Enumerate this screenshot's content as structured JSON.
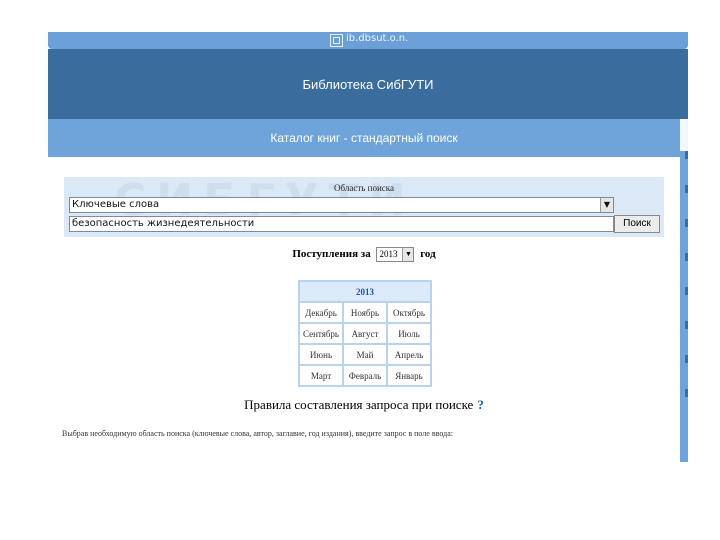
{
  "browser": {
    "url": "ib.dbsut.o.n."
  },
  "header": {
    "title": "Библиотека СибГУТИ"
  },
  "catalog": {
    "title": "Каталог книг - стандартный поиск"
  },
  "search": {
    "area_label": "Область поиска",
    "area_selected": "Ключевые слова",
    "query_value": "безопасность жизнедеятельности",
    "button_label": "Поиск",
    "watermark": "СИБГУТИ"
  },
  "arrivals": {
    "label_before": "Поступления за",
    "year_selected": "2013",
    "label_after": "год"
  },
  "calendar": {
    "year": "2013",
    "rows": [
      [
        "Декабрь",
        "Ноябрь",
        "Октябрь"
      ],
      [
        "Сентябрь",
        "Август",
        "Июль"
      ],
      [
        "Июнь",
        "Май",
        "Апрель"
      ],
      [
        "Март",
        "Февраль",
        "Январь"
      ]
    ]
  },
  "rules": {
    "text": "Правила составления запроса при поиске",
    "help_symbol": "?"
  },
  "hint": "Выбрав необходимую область поиска (ключевые слова, автор, заглавие, год издания), введите запрос в поле ввода:"
}
